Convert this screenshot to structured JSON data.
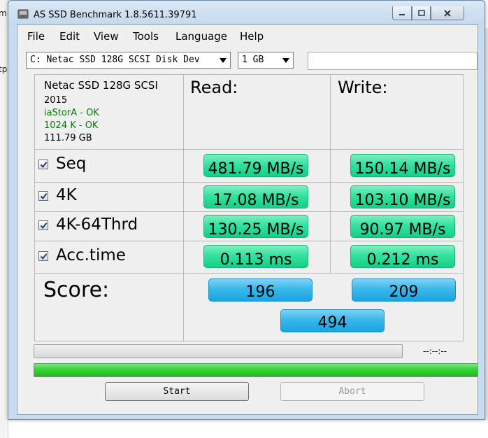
{
  "window": {
    "title": "AS SSD Benchmark 1.8.5611.39791"
  },
  "background": {
    "left_chars": [
      "m",
      "tp"
    ]
  },
  "menu": {
    "items": [
      "File",
      "Edit",
      "View",
      "Tools",
      "Language",
      "Help"
    ]
  },
  "toolbar": {
    "drive_selected": "C: Netac  SSD  128G SCSI Disk Dev",
    "size_selected": "1 GB",
    "text_value": ""
  },
  "drive_info": {
    "name": "Netac  SSD  128G SCSI",
    "year": "2015",
    "driver": "iaStorA - OK",
    "alignment": "1024 K - OK",
    "capacity": "111.79 GB"
  },
  "headers": {
    "read": "Read:",
    "write": "Write:"
  },
  "tests": [
    {
      "label": "Seq",
      "checked": true,
      "read": "481.79 MB/s",
      "write": "150.14 MB/s"
    },
    {
      "label": "4K",
      "checked": true,
      "read": "17.08 MB/s",
      "write": "103.10 MB/s"
    },
    {
      "label": "4K-64Thrd",
      "checked": true,
      "read": "130.25 MB/s",
      "write": "90.97 MB/s"
    },
    {
      "label": "Acc.time",
      "checked": true,
      "read": "0.113 ms",
      "write": "0.212 ms"
    }
  ],
  "score": {
    "label": "Score:",
    "read": "196",
    "write": "209",
    "total": "494"
  },
  "progress": {
    "time": "--:--:--",
    "overall_fraction": 1.0
  },
  "buttons": {
    "start": "Start",
    "abort": "Abort"
  },
  "colors": {
    "result_green": "#34e2a0",
    "score_blue": "#3bb7ea",
    "progress_green": "#36d336",
    "ok_green": "#007a00"
  }
}
